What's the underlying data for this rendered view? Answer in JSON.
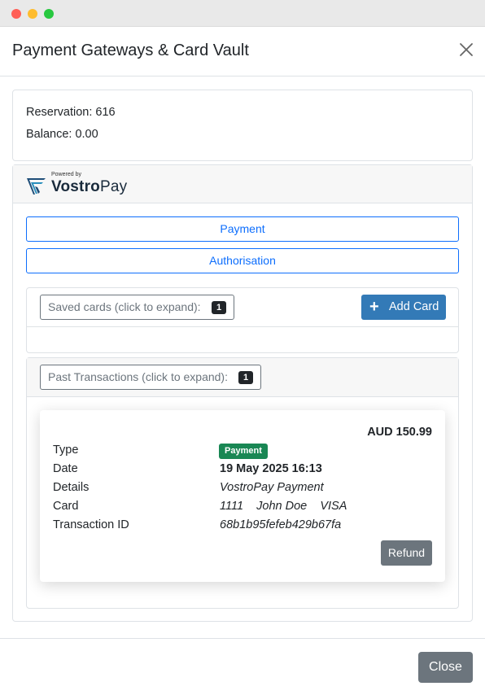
{
  "window": {
    "title": "Payment Gateways & Card Vault"
  },
  "info": {
    "reservation": "Reservation: 616",
    "balance": "Balance: 0.00"
  },
  "gateway": {
    "powered_by": "Powered by",
    "brand_part1": "Vostro",
    "brand_part2": "Pay",
    "payment_button": "Payment",
    "authorisation_button": "Authorisation"
  },
  "saved_cards": {
    "label": "Saved cards (click to expand):",
    "count": "1",
    "add_button": "Add Card"
  },
  "past_transactions": {
    "label": "Past Transactions (click to expand):",
    "count": "1",
    "transaction": {
      "amount": "AUD 150.99",
      "type_label": "Type",
      "type_value": "Payment",
      "date_label": "Date",
      "date_value": "19 May 2025 16:13",
      "details_label": "Details",
      "details_value": "VostroPay Payment",
      "card_label": "Card",
      "card_value": "1111    John Doe    VISA",
      "txn_id_label": "Transaction ID",
      "txn_id_value": "68b1b95fefeb429b67fa",
      "refund_button": "Refund"
    }
  },
  "footer": {
    "close_button": "Close"
  },
  "colors": {
    "primary": "#0d6efd",
    "add_card_bg": "#337ab7",
    "success": "#198754",
    "secondary": "#6c757d"
  }
}
